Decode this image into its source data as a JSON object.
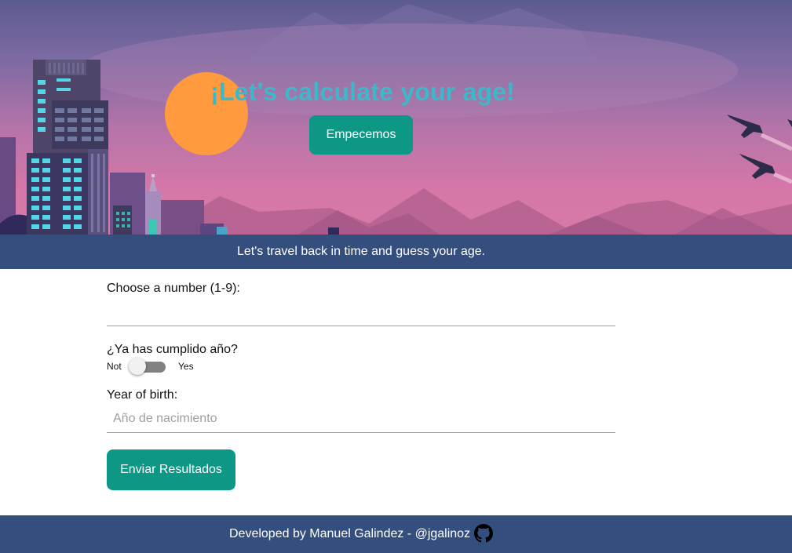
{
  "hero": {
    "title": "¡Let's calculate your age!",
    "start_button": "Empecemos"
  },
  "banner": {
    "text": "Let's travel back in time and guess your age."
  },
  "form": {
    "number_label": "Choose a number (1-9):",
    "number_value": "",
    "birthday_question": "¿Ya has cumplido año?",
    "switch_off_label": "Not",
    "switch_on_label": "Yes",
    "switch_checked": false,
    "year_label": "Year of birth:",
    "year_placeholder": "Año de nacimiento",
    "submit_button": "Enviar Resultados"
  },
  "footer": {
    "text": "Developed by Manuel Galindez - @jgalinoz",
    "icon": "github-icon"
  },
  "colors": {
    "accent": "#0d9785",
    "banner": "#344e7e",
    "title": "#3cb9c9",
    "sun": "#ff9a3e"
  }
}
